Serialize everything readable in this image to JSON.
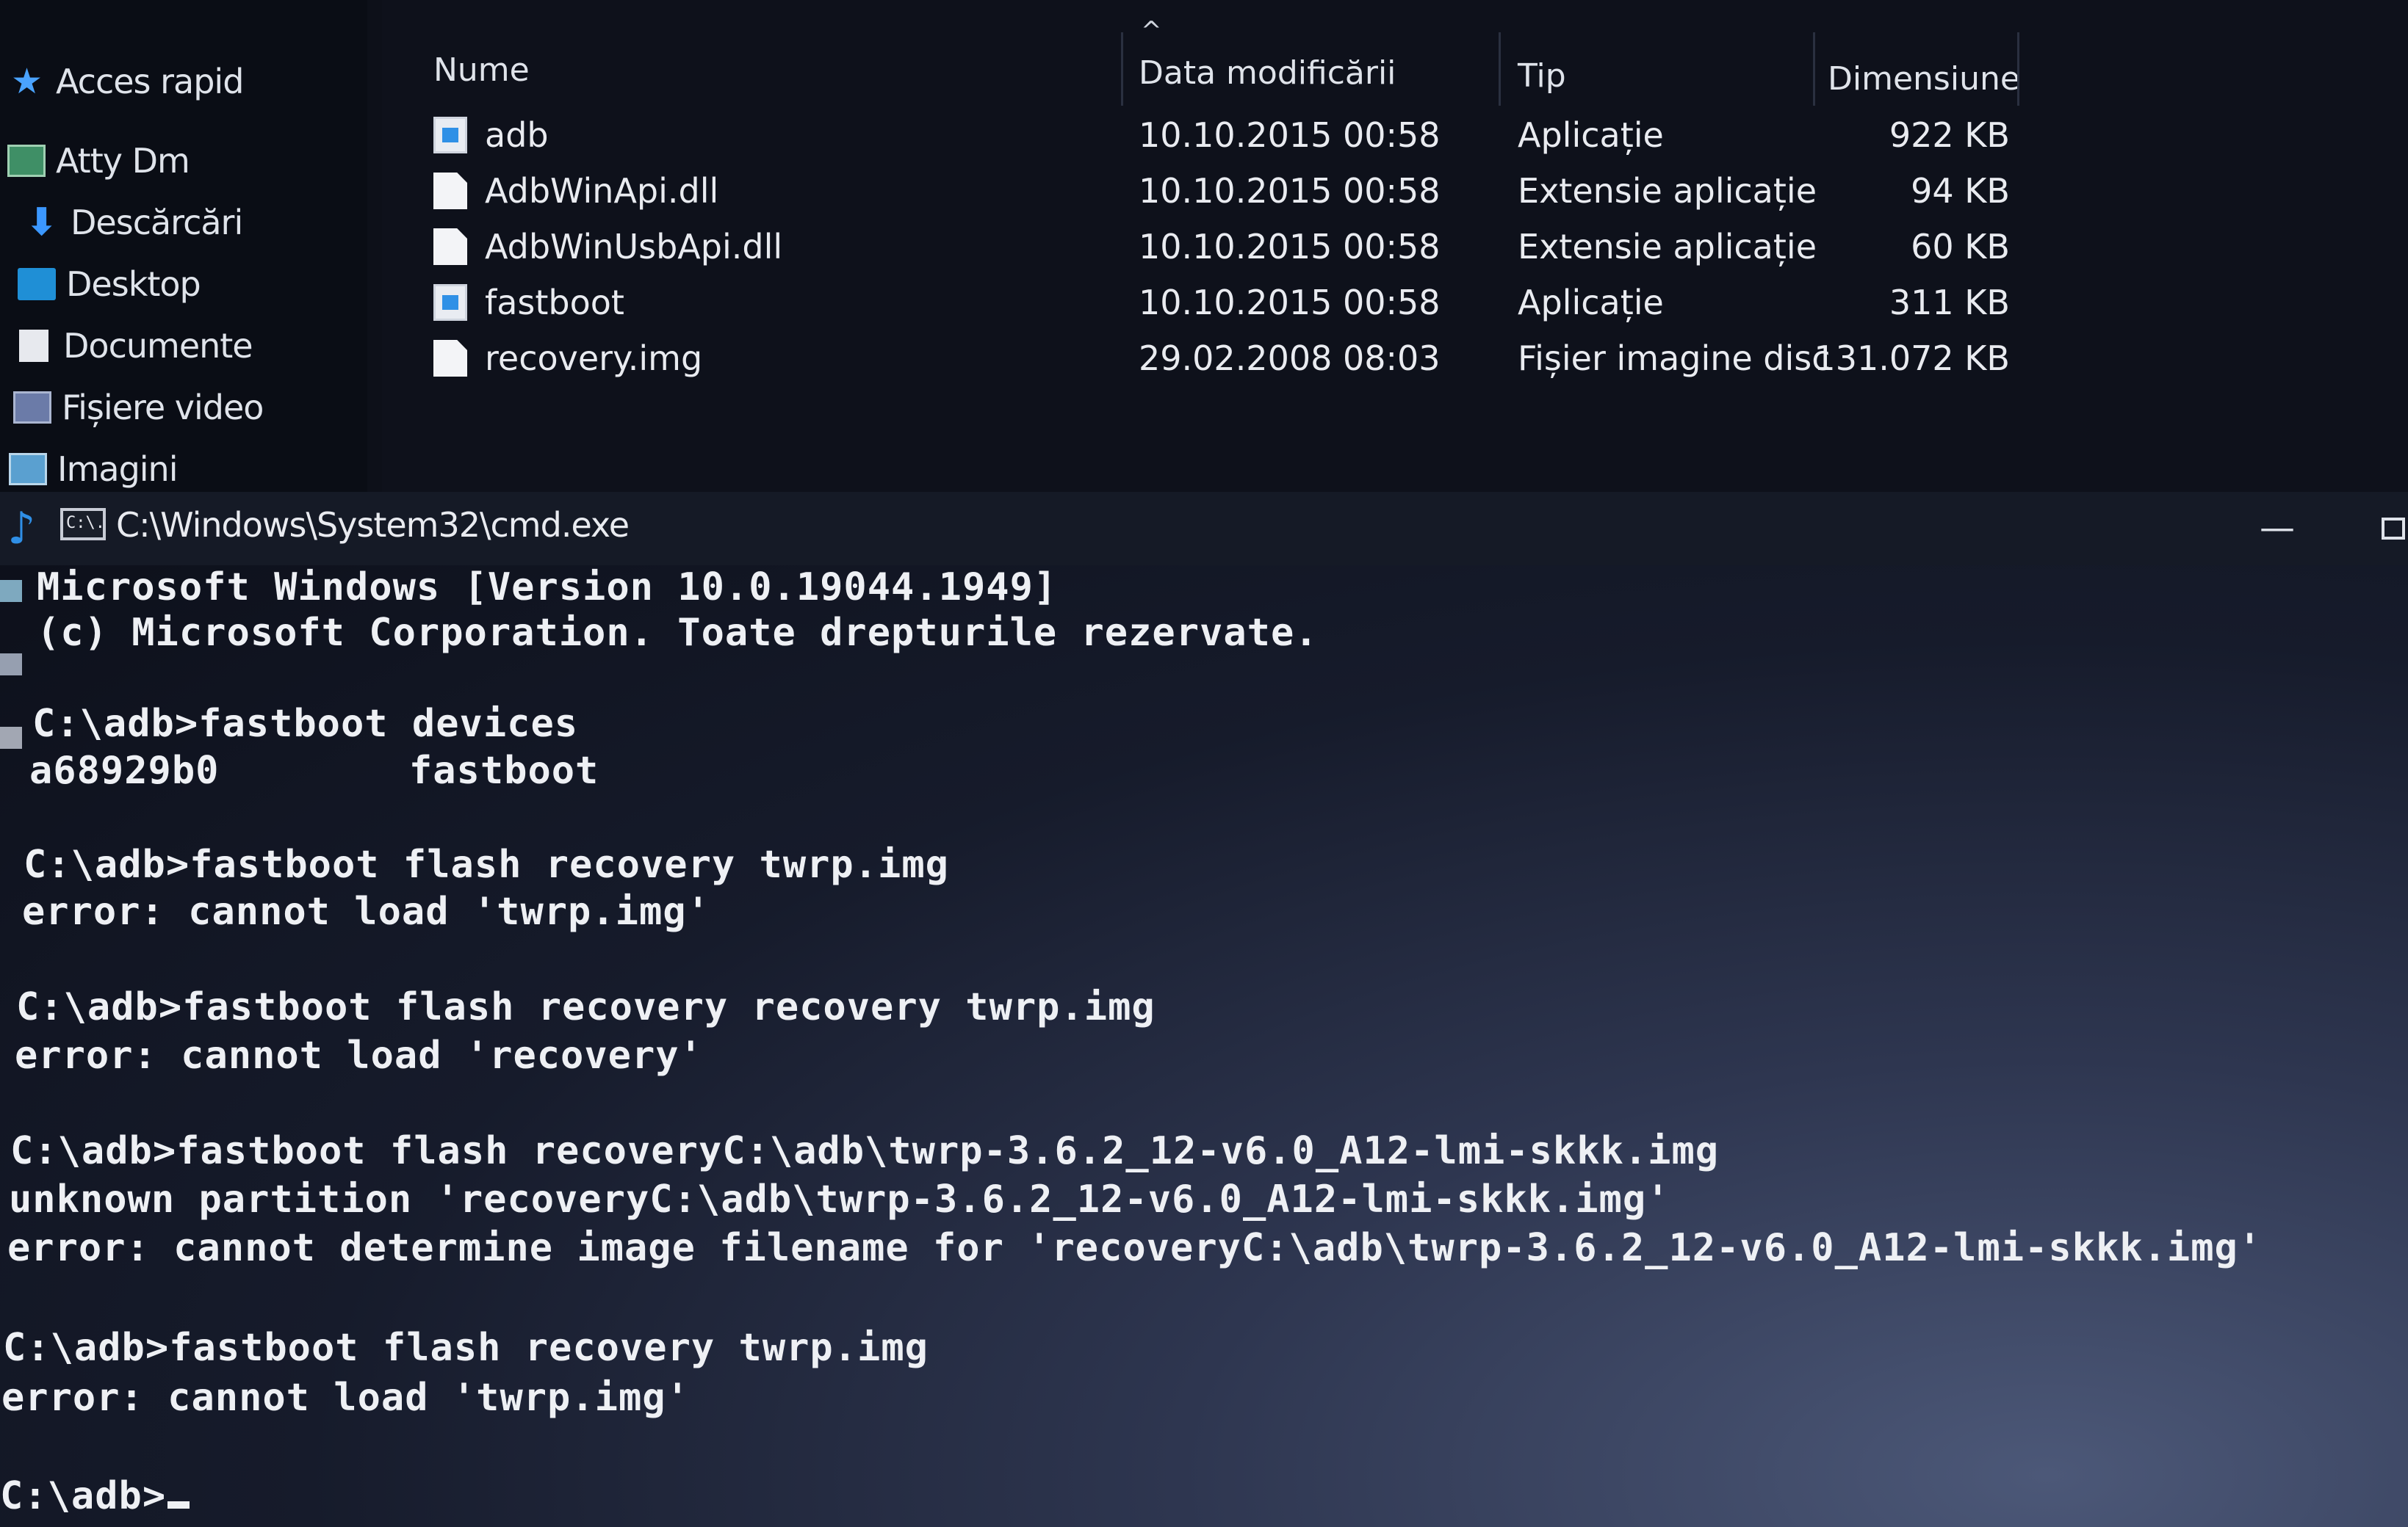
{
  "explorer": {
    "nav": [
      {
        "label": "Acces rapid",
        "icon": "star-icon"
      },
      {
        "label": "Atty Dm",
        "icon": "user-folder-icon"
      },
      {
        "label": "Descărcări",
        "icon": "download-icon"
      },
      {
        "label": "Desktop",
        "icon": "desktop-icon"
      },
      {
        "label": "Documente",
        "icon": "document-icon"
      },
      {
        "label": "Fișiere video",
        "icon": "video-icon"
      },
      {
        "label": "Imagini",
        "icon": "image-icon"
      }
    ],
    "columns": {
      "name": "Nume",
      "date": "Data modificării",
      "type": "Tip",
      "size": "Dimensiune"
    },
    "files": [
      {
        "name": "adb",
        "date": "10.10.2015 00:58",
        "type": "Aplicație",
        "size": "922 KB",
        "icon": "application-icon"
      },
      {
        "name": "AdbWinApi.dll",
        "date": "10.10.2015 00:58",
        "type": "Extensie aplicație",
        "size": "94 KB",
        "icon": "file-icon"
      },
      {
        "name": "AdbWinUsbApi.dll",
        "date": "10.10.2015 00:58",
        "type": "Extensie aplicație",
        "size": "60 KB",
        "icon": "file-icon"
      },
      {
        "name": "fastboot",
        "date": "10.10.2015 00:58",
        "type": "Aplicație",
        "size": "311 KB",
        "icon": "application-icon"
      },
      {
        "name": "recovery.img",
        "date": "29.02.2008 08:03",
        "type": "Fișier imagine disc",
        "size": "131.072 KB",
        "icon": "file-icon"
      }
    ]
  },
  "cmd": {
    "title": "C:\\Windows\\System32\\cmd.exe",
    "icon_label": "C:\\.",
    "lines": [
      "Microsoft Windows [Version 10.0.19044.1949]",
      "(c) Microsoft Corporation. Toate drepturile rezervate.",
      "C:\\adb>fastboot devices",
      "a68929b0        fastboot",
      "C:\\adb>fastboot flash recovery twrp.img",
      "error: cannot load 'twrp.img'",
      "C:\\adb>fastboot flash recovery recovery twrp.img",
      "error: cannot load 'recovery'",
      "C:\\adb>fastboot flash recoveryC:\\adb\\twrp-3.6.2_12-v6.0_A12-lmi-skkk.img",
      "unknown partition 'recoveryC:\\adb\\twrp-3.6.2_12-v6.0_A12-lmi-skkk.img'",
      "error: cannot determine image filename for 'recoveryC:\\adb\\twrp-3.6.2_12-v6.0_A12-lmi-skkk.img'",
      "C:\\adb>fastboot flash recovery twrp.img",
      "error: cannot load 'twrp.img'",
      "C:\\adb>"
    ],
    "minimize_label": "—"
  }
}
